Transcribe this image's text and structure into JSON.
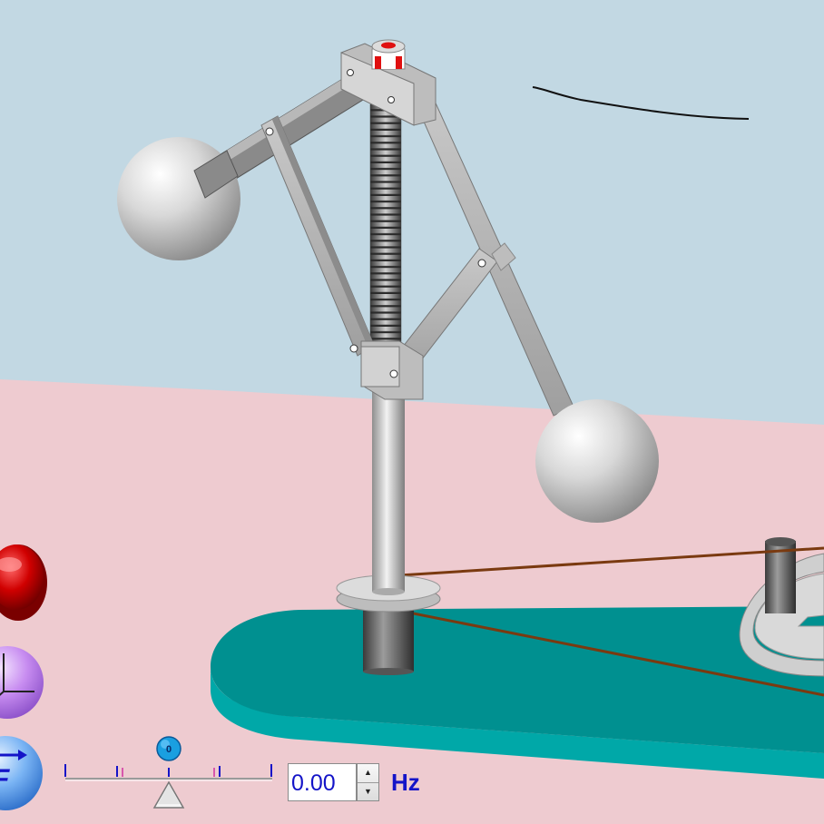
{
  "app": {
    "accent_color": "#1414c8",
    "sky_color": "#c2d8e3",
    "floor_color": "#eecbd0",
    "base_color": "#009090"
  },
  "side_buttons": [
    {
      "name": "reset-button",
      "icon": "red-dome-icon",
      "color": "#c00000"
    },
    {
      "name": "axes-button",
      "icon": "axes-icon",
      "color": "#b777e6"
    },
    {
      "name": "force-button",
      "icon": "force-vector-icon",
      "color": "#4a8fe6",
      "label": "F"
    }
  ],
  "frequency": {
    "slider_value_label": "0",
    "value": "0.00",
    "unit": "Hz"
  }
}
